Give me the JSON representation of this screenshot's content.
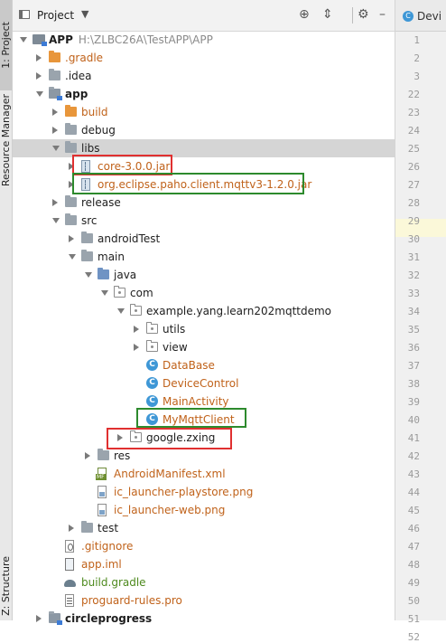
{
  "side_tabs": [
    "1: Project",
    "Resource Manager",
    "Z: Structure"
  ],
  "panel": {
    "title": "Project",
    "icons": [
      "crosshair-icon",
      "collapse-icon",
      "gear-icon",
      "minimize-icon"
    ]
  },
  "editor": {
    "tab_label": "Devi",
    "line_numbers": [
      "1",
      "2",
      "3",
      "22",
      "23",
      "24",
      "25",
      "26",
      "27",
      "28",
      "29",
      "30",
      "31",
      "32",
      "33",
      "34",
      "35",
      "36",
      "37",
      "38",
      "39",
      "40",
      "41",
      "42",
      "43",
      "44",
      "45",
      "46",
      "47",
      "48",
      "49",
      "50",
      "51",
      "52"
    ]
  },
  "tree": [
    {
      "label": "APP",
      "path": "H:\\ZLBC26A\\TestAPP\\APP",
      "type": "module",
      "depth": 0,
      "expanded": true,
      "bold": true
    },
    {
      "label": ".gradle",
      "type": "folder-orange",
      "depth": 1,
      "expanded": false,
      "color": "orange"
    },
    {
      "label": ".idea",
      "type": "folder",
      "depth": 1,
      "expanded": false
    },
    {
      "label": "app",
      "type": "module-folder",
      "depth": 1,
      "expanded": true,
      "bold": true
    },
    {
      "label": "build",
      "type": "folder-orange",
      "depth": 2,
      "expanded": false,
      "color": "orange"
    },
    {
      "label": "debug",
      "type": "folder",
      "depth": 2,
      "expanded": false
    },
    {
      "label": "libs",
      "type": "folder",
      "depth": 2,
      "expanded": true,
      "selected": true
    },
    {
      "label": "core-3.0.0.jar",
      "type": "jar",
      "depth": 3,
      "expanded": false,
      "color": "orange"
    },
    {
      "label": "org.eclipse.paho.client.mqttv3-1.2.0.jar",
      "type": "jar",
      "depth": 3,
      "expanded": false,
      "color": "orange"
    },
    {
      "label": "release",
      "type": "folder",
      "depth": 2,
      "expanded": false
    },
    {
      "label": "src",
      "type": "folder",
      "depth": 2,
      "expanded": true
    },
    {
      "label": "androidTest",
      "type": "folder",
      "depth": 3,
      "expanded": false
    },
    {
      "label": "main",
      "type": "folder",
      "depth": 3,
      "expanded": true
    },
    {
      "label": "java",
      "type": "folder-java",
      "depth": 4,
      "expanded": true
    },
    {
      "label": "com",
      "type": "package",
      "depth": 5,
      "expanded": true
    },
    {
      "label": "example.yang.learn202mqttdemo",
      "type": "package",
      "depth": 6,
      "expanded": true
    },
    {
      "label": "utils",
      "type": "package",
      "depth": 7,
      "expanded": false
    },
    {
      "label": "view",
      "type": "package",
      "depth": 7,
      "expanded": false
    },
    {
      "label": "DataBase",
      "type": "class",
      "depth": 7,
      "color": "orange"
    },
    {
      "label": "DeviceControl",
      "type": "class",
      "depth": 7,
      "color": "orange"
    },
    {
      "label": "MainActivity",
      "type": "class",
      "depth": 7,
      "color": "orange"
    },
    {
      "label": "MyMqttClient",
      "type": "class",
      "depth": 7,
      "color": "orange"
    },
    {
      "label": "google.zxing",
      "type": "package",
      "depth": 6,
      "expanded": false
    },
    {
      "label": "res",
      "type": "folder-res",
      "depth": 4,
      "expanded": false
    },
    {
      "label": "AndroidManifest.xml",
      "type": "file-xml",
      "depth": 4,
      "color": "orange"
    },
    {
      "label": "ic_launcher-playstore.png",
      "type": "file-img",
      "depth": 4,
      "color": "orange"
    },
    {
      "label": "ic_launcher-web.png",
      "type": "file-img",
      "depth": 4,
      "color": "orange"
    },
    {
      "label": "test",
      "type": "folder",
      "depth": 3,
      "expanded": false
    },
    {
      "label": ".gitignore",
      "type": "file-git",
      "depth": 2,
      "color": "orange"
    },
    {
      "label": "app.iml",
      "type": "file-iml",
      "depth": 2,
      "color": "orange"
    },
    {
      "label": "build.gradle",
      "type": "file-gradle",
      "depth": 2,
      "color": "green"
    },
    {
      "label": "proguard-rules.pro",
      "type": "file-pro",
      "depth": 2,
      "color": "orange"
    },
    {
      "label": "circleprogress",
      "type": "module-folder",
      "depth": 1,
      "expanded": false,
      "bold": true
    }
  ],
  "colors": {
    "orange": "#c0621a",
    "green": "#4e8a1e",
    "annotation_red": "#e03030",
    "annotation_green": "#2d8a2d",
    "class_icon": "#3e97d6"
  }
}
